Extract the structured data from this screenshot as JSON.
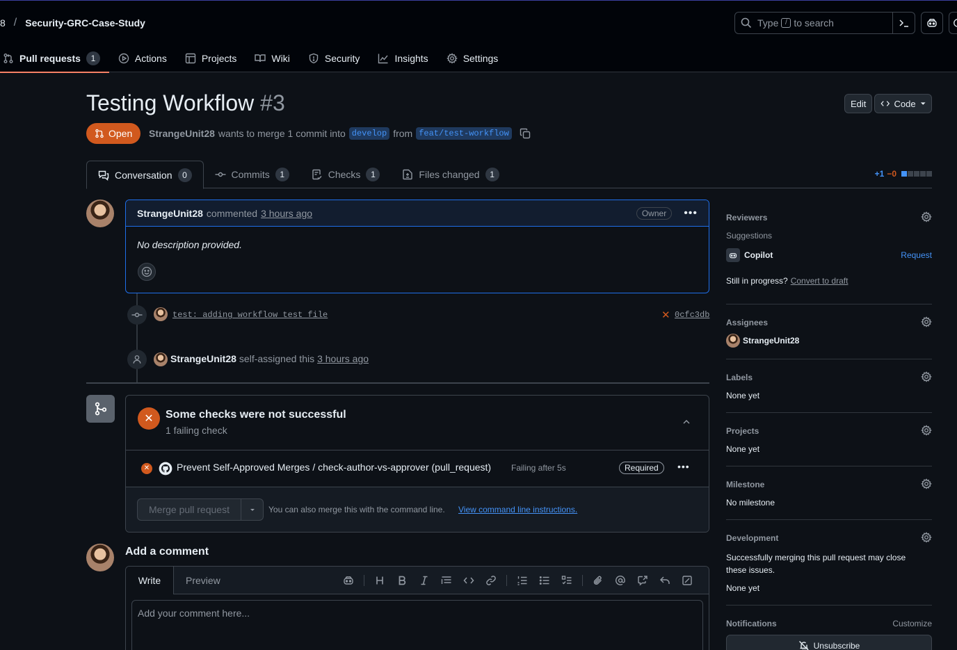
{
  "header": {
    "owner_fragment": "8",
    "separator": "/",
    "repo": "Security-GRC-Case-Study",
    "search": {
      "prefix": "Type",
      "key": "/",
      "suffix": "to search"
    }
  },
  "nav": {
    "tabs": [
      {
        "label": "Pull requests",
        "count": "1",
        "icon": "git-pull-request-icon"
      },
      {
        "label": "Actions",
        "icon": "play-icon"
      },
      {
        "label": "Projects",
        "icon": "table-icon"
      },
      {
        "label": "Wiki",
        "icon": "book-icon"
      },
      {
        "label": "Security",
        "icon": "shield-icon"
      },
      {
        "label": "Insights",
        "icon": "graph-icon"
      },
      {
        "label": "Settings",
        "icon": "gear-icon"
      }
    ]
  },
  "pr": {
    "title": "Testing Workflow",
    "number": "#3",
    "edit_label": "Edit",
    "code_label": "Code",
    "state": "Open",
    "author": "StrangeUnit28",
    "merge_text": "wants to merge 1 commit into",
    "base_branch": "develop",
    "from_text": "from",
    "head_branch": "feat/test-workflow"
  },
  "tabs": [
    {
      "label": "Conversation",
      "count": "0"
    },
    {
      "label": "Commits",
      "count": "1"
    },
    {
      "label": "Checks",
      "count": "1"
    },
    {
      "label": "Files changed",
      "count": "1"
    }
  ],
  "diffstat": {
    "additions": "+1",
    "deletions": "−0"
  },
  "comment": {
    "author": "StrangeUnit28",
    "action": "commented",
    "time": "3 hours ago",
    "role": "Owner",
    "body": "No description provided."
  },
  "timeline": {
    "commit_message": "test: adding workflow test file",
    "commit_sha": "0cfc3db",
    "event_user": "StrangeUnit28",
    "event_action": "self-assigned this",
    "event_time": "3 hours ago"
  },
  "checks": {
    "title": "Some checks were not successful",
    "subtitle": "1 failing check",
    "check_name": "Prevent Self-Approved Merges / check-author-vs-approver (pull_request)",
    "check_status": "Failing after 5s",
    "required_label": "Required",
    "merge_button": "Merge pull request",
    "merge_hint": "You can also merge this with the command line.",
    "merge_link": "View command line instructions."
  },
  "add_comment": {
    "heading": "Add a comment",
    "write_tab": "Write",
    "preview_tab": "Preview",
    "placeholder": "Add your comment here..."
  },
  "sidebar": {
    "reviewers": {
      "heading": "Reviewers",
      "suggestions": "Suggestions",
      "suggested": "Copilot",
      "request": "Request",
      "draft_prefix": "Still in progress?",
      "draft_link": "Convert to draft"
    },
    "assignees": {
      "heading": "Assignees",
      "user": "StrangeUnit28"
    },
    "labels": {
      "heading": "Labels",
      "value": "None yet"
    },
    "projects": {
      "heading": "Projects",
      "value": "None yet"
    },
    "milestone": {
      "heading": "Milestone",
      "value": "No milestone"
    },
    "development": {
      "heading": "Development",
      "text": "Successfully merging this pull request may close these issues.",
      "value": "None yet"
    },
    "notifications": {
      "heading": "Notifications",
      "customize": "Customize",
      "unsubscribe": "Unsubscribe"
    }
  },
  "colors": {
    "accent": "#f78166",
    "open": "#d1591e",
    "link": "#4493f8",
    "background": "#0d1117"
  }
}
